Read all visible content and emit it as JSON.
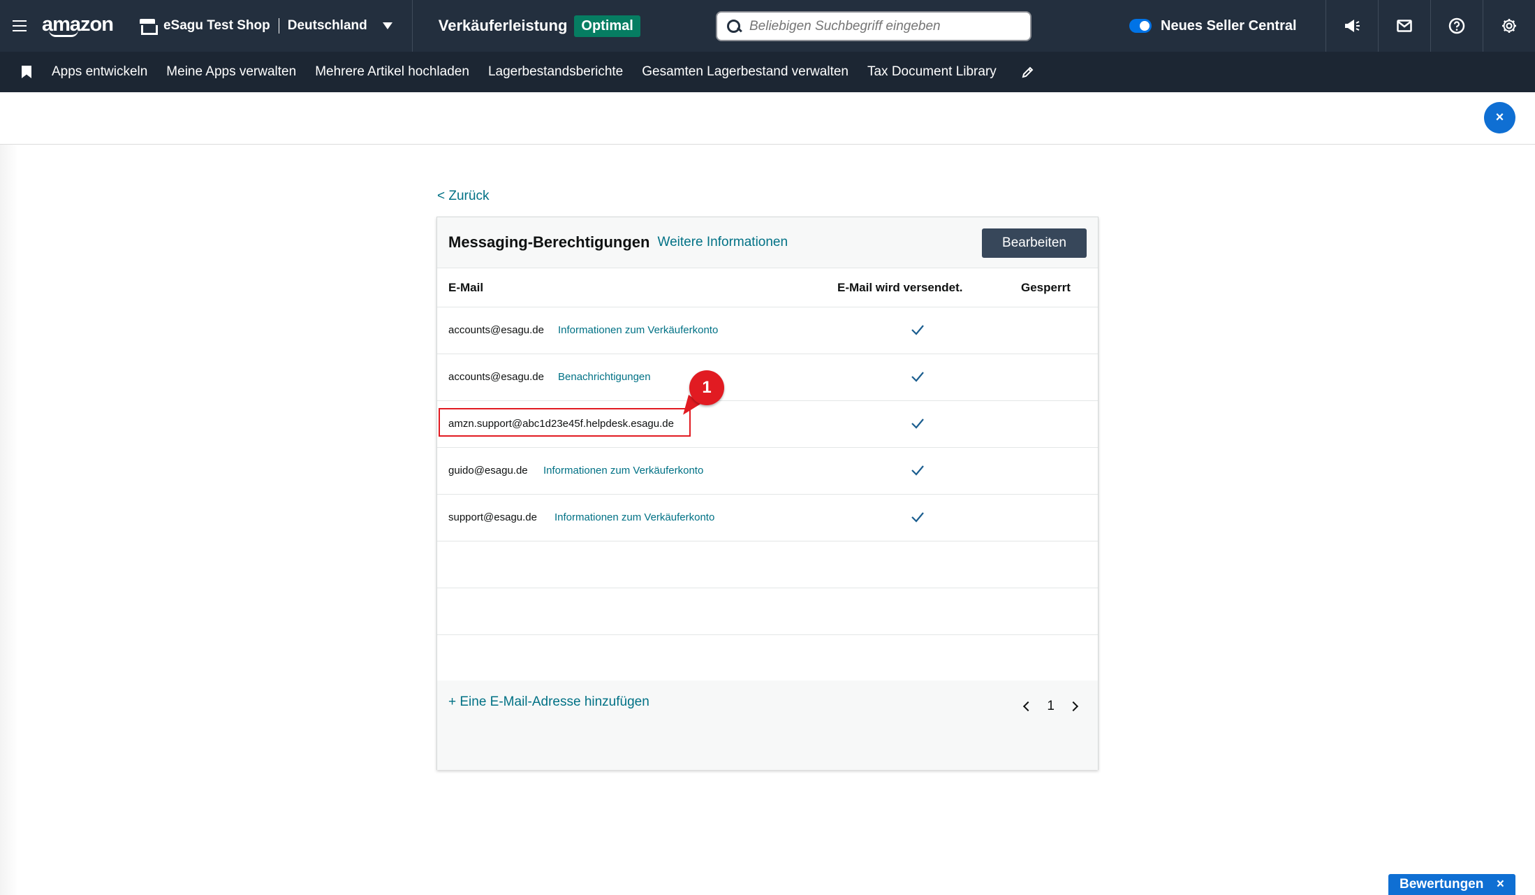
{
  "topbar": {
    "logo": "amazon",
    "shop_name": "eSagu Test Shop",
    "country": "Deutschland",
    "performance_label": "Verkäuferleistung",
    "performance_badge": "Optimal",
    "search_placeholder": "Beliebigen Suchbegriff eingeben",
    "toggle_label": "Neues Seller Central"
  },
  "navbar": {
    "links": [
      "Apps entwickeln",
      "Meine Apps verwalten",
      "Mehrere Artikel hochladen",
      "Lagerbestandsberichte",
      "Gesamten Lagerbestand verwalten",
      "Tax Document Library"
    ]
  },
  "close_label": "×",
  "back_link": "< Zurück",
  "card": {
    "title": "Messaging-Berechtigungen",
    "more_info": "Weitere Informationen",
    "edit_button": "Bearbeiten",
    "columns": [
      "E-Mail",
      "E-Mail wird versendet.",
      "Gesperrt"
    ],
    "rows": [
      {
        "email": "accounts@esagu.de",
        "link": "Informationen zum Verkäuferkonto",
        "sent": true
      },
      {
        "email": "accounts@esagu.de",
        "link": "Benachrichtigungen",
        "sent": true
      },
      {
        "email": "amzn.support@abc1d23e45f.helpdesk.esagu.de",
        "link": "",
        "sent": true
      },
      {
        "email": "guido@esagu.de",
        "link": "Informationen zum Verkäuferkonto",
        "sent": true
      },
      {
        "email": "support@esagu.de",
        "link": "Informationen zum Verkäuferkonto",
        "sent": true
      }
    ],
    "add_link": "+ Eine E-Mail-Adresse hinzufügen",
    "page_number": "1"
  },
  "annotation_marker": "1",
  "feedback": {
    "label": "Bewertungen",
    "close": "×"
  },
  "colors": {
    "accent": "#007185",
    "badge": "#067d62",
    "marker": "#e11b22",
    "topbar": "#232f3e"
  }
}
